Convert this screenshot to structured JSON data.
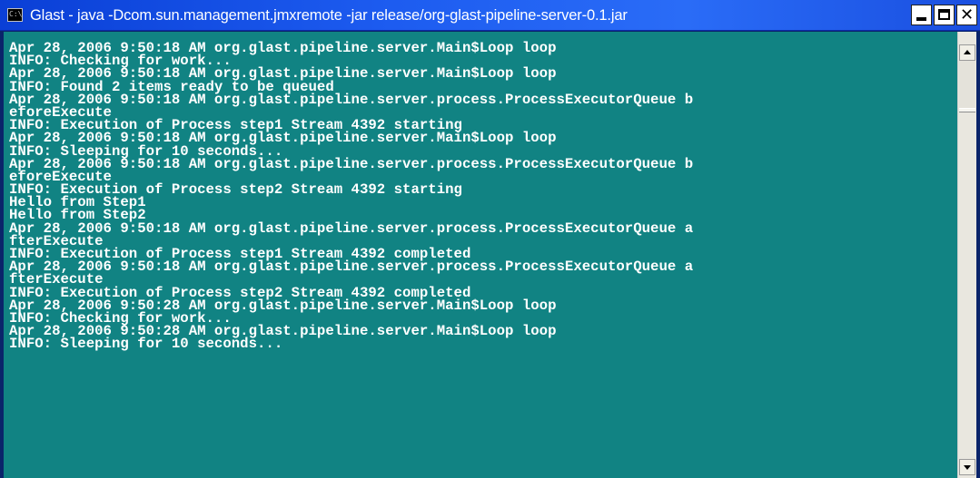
{
  "window": {
    "title": "Glast - java -Dcom.sun.management.jmxremote -jar release/org-glast-pipeline-server-0.1.jar",
    "icon": "console-app-icon",
    "icon_label": "C:\\",
    "buttons": {
      "minimize": "minimize-icon",
      "maximize": "maximize-icon",
      "close": "close-icon",
      "close_glyph": "✕"
    }
  },
  "colors": {
    "titlebar": "#1d5cf0",
    "console_bg": "#118383",
    "console_text": "#ffffff",
    "scrollbar": "#e9e7df"
  },
  "console": {
    "lines": [
      "Apr 28, 2006 9:50:18 AM org.glast.pipeline.server.Main$Loop loop",
      "INFO: Checking for work...",
      "Apr 28, 2006 9:50:18 AM org.glast.pipeline.server.Main$Loop loop",
      "INFO: Found 2 items ready to be queued",
      "Apr 28, 2006 9:50:18 AM org.glast.pipeline.server.process.ProcessExecutorQueue b",
      "eforeExecute",
      "INFO: Execution of Process step1 Stream 4392 starting",
      "Apr 28, 2006 9:50:18 AM org.glast.pipeline.server.Main$Loop loop",
      "INFO: Sleeping for 10 seconds...",
      "Apr 28, 2006 9:50:18 AM org.glast.pipeline.server.process.ProcessExecutorQueue b",
      "eforeExecute",
      "INFO: Execution of Process step2 Stream 4392 starting",
      "Hello from Step1",
      "Hello from Step2",
      "Apr 28, 2006 9:50:18 AM org.glast.pipeline.server.process.ProcessExecutorQueue a",
      "fterExecute",
      "INFO: Execution of Process step1 Stream 4392 completed",
      "Apr 28, 2006 9:50:18 AM org.glast.pipeline.server.process.ProcessExecutorQueue a",
      "fterExecute",
      "INFO: Execution of Process step2 Stream 4392 completed",
      "Apr 28, 2006 9:50:28 AM org.glast.pipeline.server.Main$Loop loop",
      "INFO: Checking for work...",
      "Apr 28, 2006 9:50:28 AM org.glast.pipeline.server.Main$Loop loop",
      "INFO: Sleeping for 10 seconds..."
    ]
  },
  "scrollbar": {
    "up_icon": "scroll-up-arrow-icon",
    "down_icon": "scroll-down-arrow-icon",
    "position": "bottom"
  }
}
